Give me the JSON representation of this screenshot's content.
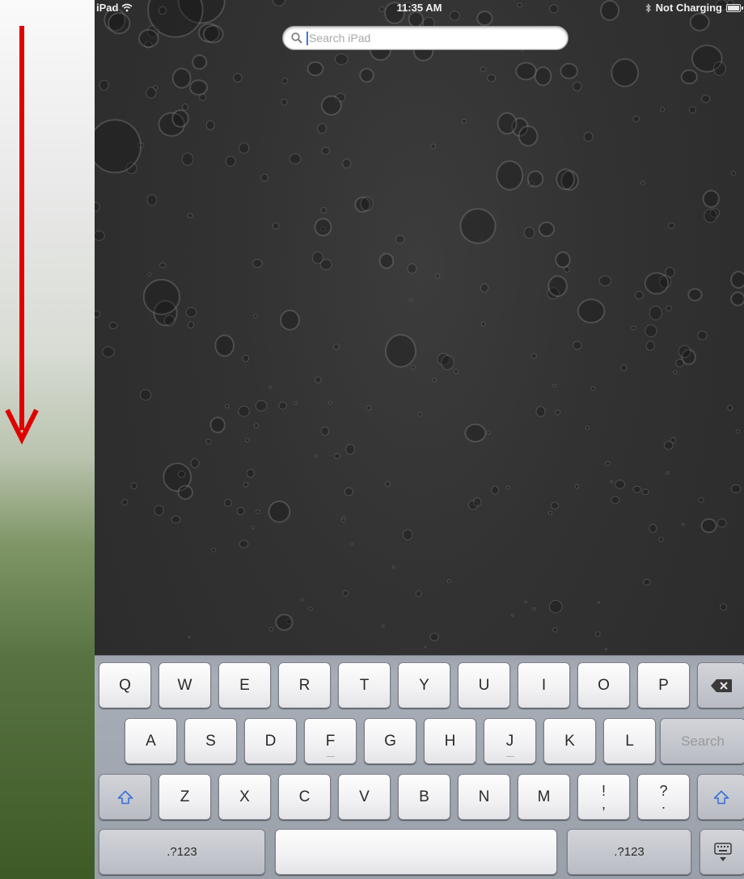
{
  "status_bar": {
    "device": "iPad",
    "time": "11:35 AM",
    "charging": "Not Charging"
  },
  "search": {
    "placeholder": "Search iPad",
    "value": ""
  },
  "keyboard": {
    "row1": [
      "Q",
      "W",
      "E",
      "R",
      "T",
      "Y",
      "U",
      "I",
      "O",
      "P"
    ],
    "row2": [
      "A",
      "S",
      "D",
      "F",
      "G",
      "H",
      "J",
      "K",
      "L"
    ],
    "search_key": "Search",
    "row3": [
      "Z",
      "X",
      "C",
      "V",
      "B",
      "N",
      "M"
    ],
    "exclaim_top": "!",
    "exclaim_bottom": ",",
    "question_top": "?",
    "question_bottom": ".",
    "numbers_left": ".?123",
    "numbers_right": ".?123"
  },
  "colors": {
    "arrow": "#e00000",
    "caret": "#3b78e7",
    "shift_icon": "#3a6fd8"
  },
  "icons": [
    "wifi-icon",
    "bluetooth-icon",
    "battery-icon",
    "search-icon",
    "backspace-icon",
    "shift-icon",
    "keyboard-dismiss-icon",
    "down-arrow-icon"
  ]
}
